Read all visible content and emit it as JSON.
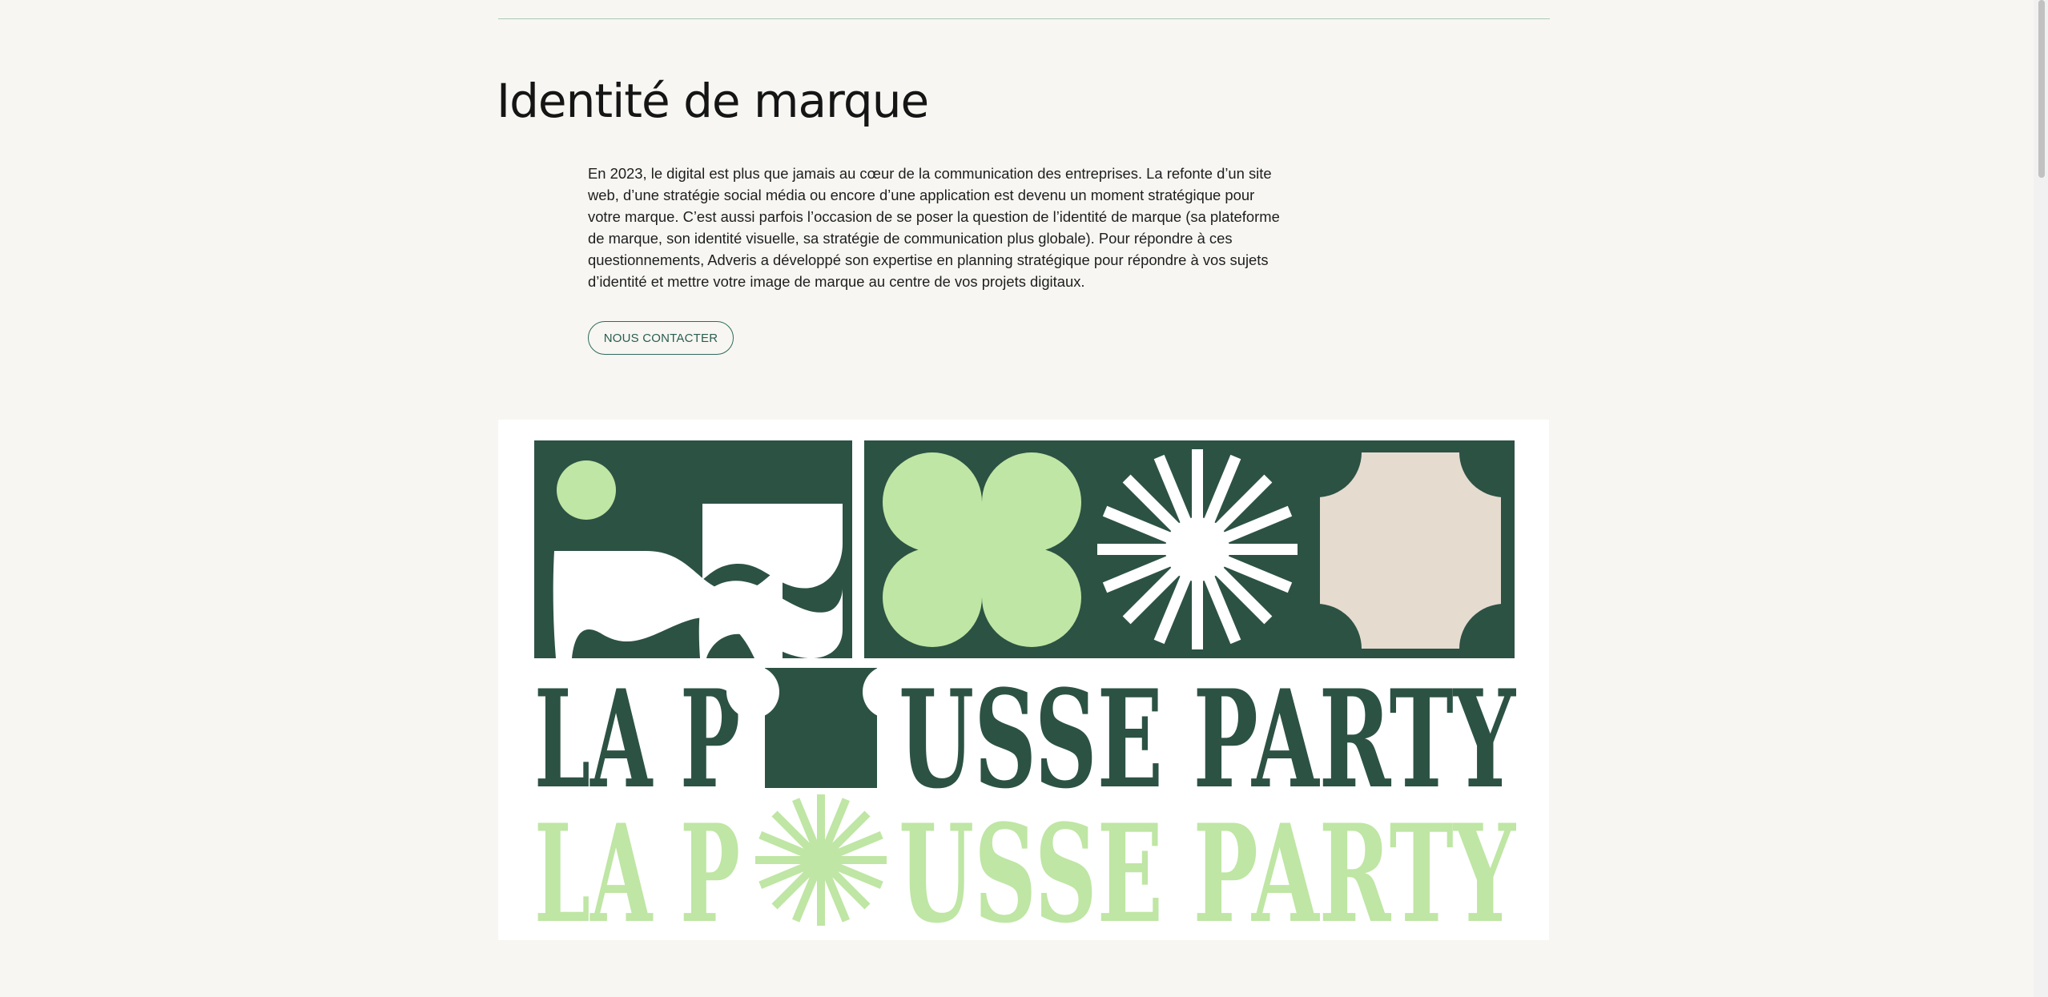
{
  "section": {
    "title": "Identité de marque",
    "intro_lines": [
      "En 2023, le digital est plus que jamais au cœur de la communication des entreprises. La refonte d’un site",
      "web, d’une stratégie social média ou encore d’une application est devenu un moment stratégique pour",
      "votre marque. C’est aussi parfois l’occasion de se poser la question de l’identité de marque (sa plateforme",
      "de marque, son identité visuelle, sa stratégie de communication plus globale). Pour répondre à ces",
      "questionnements, Adveris a développé son expertise en planning stratégique pour répondre à vos sujets",
      "d’identité et mettre votre image de marque au centre de vos projets digitaux."
    ],
    "cta_label": "NOUS CONTACTER"
  },
  "visual": {
    "wordmark_left": "LA P",
    "wordmark_right": "USSE PARTY",
    "colors": {
      "dark_green": "#2c5244",
      "light_green": "#bfe6a4",
      "beige": "#e6dbcf",
      "white": "#ffffff"
    }
  }
}
